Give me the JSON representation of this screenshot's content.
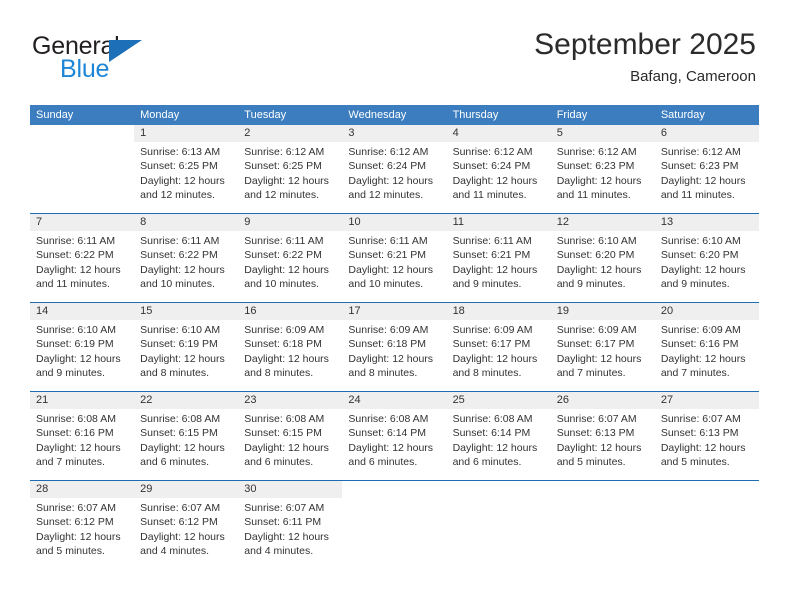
{
  "brand": {
    "name_part1": "General",
    "name_part2": "Blue",
    "color_dark": "#231f20",
    "color_blue": "#1d86d6",
    "triangle_color": "#1d6fb8"
  },
  "header": {
    "title": "September 2025",
    "subtitle": "Bafang, Cameroon"
  },
  "theme": {
    "header_blue": "#3b7dbf",
    "week_divider_blue": "#1f6cb0",
    "daynum_band": "#efefef",
    "text": "#333333"
  },
  "weekdays": [
    "Sunday",
    "Monday",
    "Tuesday",
    "Wednesday",
    "Thursday",
    "Friday",
    "Saturday"
  ],
  "weeks": [
    {
      "days": [
        {
          "num": "",
          "lines": [
            "",
            "",
            "",
            ""
          ],
          "empty": true
        },
        {
          "num": "1",
          "lines": [
            "Sunrise: 6:13 AM",
            "Sunset: 6:25 PM",
            "Daylight: 12 hours",
            "and 12 minutes."
          ],
          "empty": false
        },
        {
          "num": "2",
          "lines": [
            "Sunrise: 6:12 AM",
            "Sunset: 6:25 PM",
            "Daylight: 12 hours",
            "and 12 minutes."
          ],
          "empty": false
        },
        {
          "num": "3",
          "lines": [
            "Sunrise: 6:12 AM",
            "Sunset: 6:24 PM",
            "Daylight: 12 hours",
            "and 12 minutes."
          ],
          "empty": false
        },
        {
          "num": "4",
          "lines": [
            "Sunrise: 6:12 AM",
            "Sunset: 6:24 PM",
            "Daylight: 12 hours",
            "and 11 minutes."
          ],
          "empty": false
        },
        {
          "num": "5",
          "lines": [
            "Sunrise: 6:12 AM",
            "Sunset: 6:23 PM",
            "Daylight: 12 hours",
            "and 11 minutes."
          ],
          "empty": false
        },
        {
          "num": "6",
          "lines": [
            "Sunrise: 6:12 AM",
            "Sunset: 6:23 PM",
            "Daylight: 12 hours",
            "and 11 minutes."
          ],
          "empty": false
        }
      ]
    },
    {
      "days": [
        {
          "num": "7",
          "lines": [
            "Sunrise: 6:11 AM",
            "Sunset: 6:22 PM",
            "Daylight: 12 hours",
            "and 11 minutes."
          ],
          "empty": false
        },
        {
          "num": "8",
          "lines": [
            "Sunrise: 6:11 AM",
            "Sunset: 6:22 PM",
            "Daylight: 12 hours",
            "and 10 minutes."
          ],
          "empty": false
        },
        {
          "num": "9",
          "lines": [
            "Sunrise: 6:11 AM",
            "Sunset: 6:22 PM",
            "Daylight: 12 hours",
            "and 10 minutes."
          ],
          "empty": false
        },
        {
          "num": "10",
          "lines": [
            "Sunrise: 6:11 AM",
            "Sunset: 6:21 PM",
            "Daylight: 12 hours",
            "and 10 minutes."
          ],
          "empty": false
        },
        {
          "num": "11",
          "lines": [
            "Sunrise: 6:11 AM",
            "Sunset: 6:21 PM",
            "Daylight: 12 hours",
            "and 9 minutes."
          ],
          "empty": false
        },
        {
          "num": "12",
          "lines": [
            "Sunrise: 6:10 AM",
            "Sunset: 6:20 PM",
            "Daylight: 12 hours",
            "and 9 minutes."
          ],
          "empty": false
        },
        {
          "num": "13",
          "lines": [
            "Sunrise: 6:10 AM",
            "Sunset: 6:20 PM",
            "Daylight: 12 hours",
            "and 9 minutes."
          ],
          "empty": false
        }
      ]
    },
    {
      "days": [
        {
          "num": "14",
          "lines": [
            "Sunrise: 6:10 AM",
            "Sunset: 6:19 PM",
            "Daylight: 12 hours",
            "and 9 minutes."
          ],
          "empty": false
        },
        {
          "num": "15",
          "lines": [
            "Sunrise: 6:10 AM",
            "Sunset: 6:19 PM",
            "Daylight: 12 hours",
            "and 8 minutes."
          ],
          "empty": false
        },
        {
          "num": "16",
          "lines": [
            "Sunrise: 6:09 AM",
            "Sunset: 6:18 PM",
            "Daylight: 12 hours",
            "and 8 minutes."
          ],
          "empty": false
        },
        {
          "num": "17",
          "lines": [
            "Sunrise: 6:09 AM",
            "Sunset: 6:18 PM",
            "Daylight: 12 hours",
            "and 8 minutes."
          ],
          "empty": false
        },
        {
          "num": "18",
          "lines": [
            "Sunrise: 6:09 AM",
            "Sunset: 6:17 PM",
            "Daylight: 12 hours",
            "and 8 minutes."
          ],
          "empty": false
        },
        {
          "num": "19",
          "lines": [
            "Sunrise: 6:09 AM",
            "Sunset: 6:17 PM",
            "Daylight: 12 hours",
            "and 7 minutes."
          ],
          "empty": false
        },
        {
          "num": "20",
          "lines": [
            "Sunrise: 6:09 AM",
            "Sunset: 6:16 PM",
            "Daylight: 12 hours",
            "and 7 minutes."
          ],
          "empty": false
        }
      ]
    },
    {
      "days": [
        {
          "num": "21",
          "lines": [
            "Sunrise: 6:08 AM",
            "Sunset: 6:16 PM",
            "Daylight: 12 hours",
            "and 7 minutes."
          ],
          "empty": false
        },
        {
          "num": "22",
          "lines": [
            "Sunrise: 6:08 AM",
            "Sunset: 6:15 PM",
            "Daylight: 12 hours",
            "and 6 minutes."
          ],
          "empty": false
        },
        {
          "num": "23",
          "lines": [
            "Sunrise: 6:08 AM",
            "Sunset: 6:15 PM",
            "Daylight: 12 hours",
            "and 6 minutes."
          ],
          "empty": false
        },
        {
          "num": "24",
          "lines": [
            "Sunrise: 6:08 AM",
            "Sunset: 6:14 PM",
            "Daylight: 12 hours",
            "and 6 minutes."
          ],
          "empty": false
        },
        {
          "num": "25",
          "lines": [
            "Sunrise: 6:08 AM",
            "Sunset: 6:14 PM",
            "Daylight: 12 hours",
            "and 6 minutes."
          ],
          "empty": false
        },
        {
          "num": "26",
          "lines": [
            "Sunrise: 6:07 AM",
            "Sunset: 6:13 PM",
            "Daylight: 12 hours",
            "and 5 minutes."
          ],
          "empty": false
        },
        {
          "num": "27",
          "lines": [
            "Sunrise: 6:07 AM",
            "Sunset: 6:13 PM",
            "Daylight: 12 hours",
            "and 5 minutes."
          ],
          "empty": false
        }
      ]
    },
    {
      "days": [
        {
          "num": "28",
          "lines": [
            "Sunrise: 6:07 AM",
            "Sunset: 6:12 PM",
            "Daylight: 12 hours",
            "and 5 minutes."
          ],
          "empty": false
        },
        {
          "num": "29",
          "lines": [
            "Sunrise: 6:07 AM",
            "Sunset: 6:12 PM",
            "Daylight: 12 hours",
            "and 4 minutes."
          ],
          "empty": false
        },
        {
          "num": "30",
          "lines": [
            "Sunrise: 6:07 AM",
            "Sunset: 6:11 PM",
            "Daylight: 12 hours",
            "and 4 minutes."
          ],
          "empty": false
        },
        {
          "num": "",
          "lines": [
            "",
            "",
            "",
            ""
          ],
          "empty": true
        },
        {
          "num": "",
          "lines": [
            "",
            "",
            "",
            ""
          ],
          "empty": true
        },
        {
          "num": "",
          "lines": [
            "",
            "",
            "",
            ""
          ],
          "empty": true
        },
        {
          "num": "",
          "lines": [
            "",
            "",
            "",
            ""
          ],
          "empty": true
        }
      ]
    }
  ]
}
